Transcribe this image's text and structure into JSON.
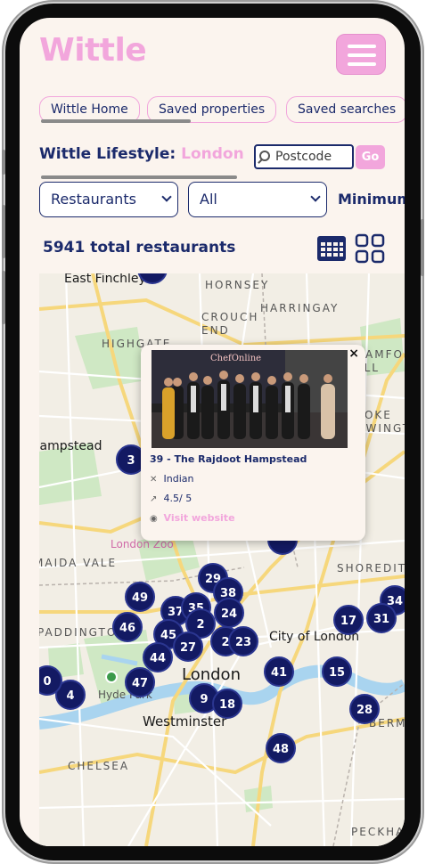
{
  "header": {
    "logo": "Wittle"
  },
  "tabs": [
    "Wittle Home",
    "Saved properties",
    "Saved searches"
  ],
  "lifestyle": {
    "label": "Wittle Lifestyle:",
    "city": "London"
  },
  "postcode": {
    "placeholder": "Postcode",
    "go_label": "Go"
  },
  "filters": {
    "category": "Restaurants",
    "cuisine": "All",
    "minimum_label": "Minimum"
  },
  "results": {
    "total_label": "5941 total restaurants"
  },
  "map": {
    "labels": [
      "East Finchley",
      "HORNSEY",
      "HARRINGAY",
      "CROUCH END",
      "HIGHGATE",
      "Hampstead",
      "STAMFORD HILL",
      "STOKE NEWINGTON",
      "London Zoo",
      "MAIDA VALE",
      "SHOREDITCH",
      "PADDINGTON",
      "City of London",
      "Hyde Park",
      "London",
      "Westminster",
      "CHELSEA",
      "BERMONDSEY",
      "PECKHAM"
    ],
    "clusters": [
      "49",
      "29",
      "38",
      "37",
      "35",
      "24",
      "46",
      "45",
      "2",
      "2",
      "23",
      "27",
      "44",
      "34",
      "17",
      "31",
      "41",
      "15",
      "47",
      "9",
      "18",
      "4",
      "0",
      "28",
      "48",
      "3"
    ]
  },
  "popup": {
    "close": "×",
    "photo_caption": "ChefOnline",
    "name": "39 - The Rajdoot Hampstead",
    "cuisine": "Indian",
    "rating": "4.5/ 5",
    "link": "Visit website"
  }
}
